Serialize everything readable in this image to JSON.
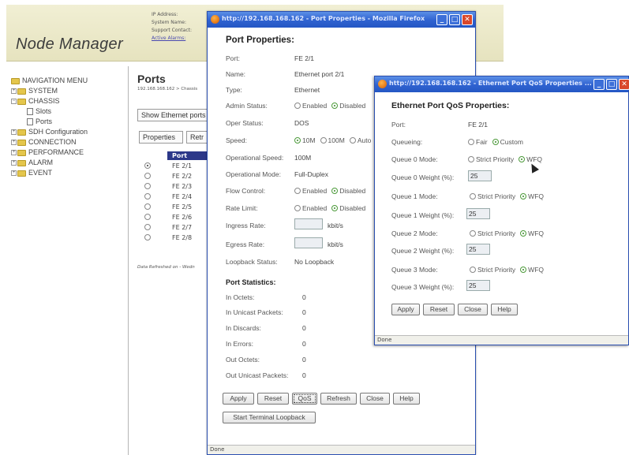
{
  "app": {
    "logo": "Node Manager",
    "header_fields": [
      "IP Address:",
      "System Name:",
      "Support Contact:",
      "Active Alarms:"
    ]
  },
  "nav": {
    "title": "NAVIGATION MENU",
    "items": [
      "SYSTEM",
      "CHASSIS",
      "Slots",
      "Ports",
      "SDH Configuration",
      "CONNECTION",
      "PERFORMANCE",
      "ALARM",
      "EVENT"
    ]
  },
  "ports_page": {
    "title": "Ports",
    "breadcrumb": "192.168.168.162 > Chassis",
    "filter_select": "Show Ethernet ports",
    "buttons": [
      "Properties",
      "Retr"
    ],
    "table_header": "Port",
    "rows": [
      "FE 2/1",
      "FE 2/2",
      "FE 2/3",
      "FE 2/4",
      "FE 2/5",
      "FE 2/6",
      "FE 2/7",
      "FE 2/8"
    ],
    "refresh_note": "Data Refreshed on - Wedn"
  },
  "port_window": {
    "title": "http://192.168.168.162 - Port Properties - Mozilla Firefox",
    "heading": "Port Properties:",
    "fields": {
      "port": {
        "label": "Port:",
        "value": "FE 2/1"
      },
      "name": {
        "label": "Name:",
        "value": "Ethernet port 2/1"
      },
      "type": {
        "label": "Type:",
        "value": "Ethernet"
      },
      "admin_status": {
        "label": "Admin Status:",
        "opt1": "Enabled",
        "opt2": "Disabled"
      },
      "oper_status": {
        "label": "Oper Status:",
        "value": "DOS"
      },
      "speed": {
        "label": "Speed:",
        "opt1": "10M",
        "opt2": "100M",
        "opt3": "Auto"
      },
      "op_speed": {
        "label": "Operational Speed:",
        "value": "100M"
      },
      "op_mode": {
        "label": "Operational Mode:",
        "value": "Full-Duplex"
      },
      "flow_control": {
        "label": "Flow Control:",
        "opt1": "Enabled",
        "opt2": "Disabled"
      },
      "rate_limit": {
        "label": "Rate Limit:",
        "opt1": "Enabled",
        "opt2": "Disabled"
      },
      "ingress": {
        "label": "Ingress Rate:",
        "unit": "kbit/s"
      },
      "egress": {
        "label": "Egress Rate:",
        "unit": "kbit/s"
      },
      "loopback": {
        "label": "Loopback Status:",
        "value": "No Loopback"
      }
    },
    "stats_heading": "Port Statistics:",
    "stats": [
      {
        "label": "In Octets:",
        "value": "0"
      },
      {
        "label": "In Unicast Packets:",
        "value": "0"
      },
      {
        "label": "In Discards:",
        "value": "0"
      },
      {
        "label": "In Errors:",
        "value": "0"
      },
      {
        "label": "Out Octets:",
        "value": "0"
      },
      {
        "label": "Out Unicast Packets:",
        "value": "0"
      }
    ],
    "buttons": {
      "apply": "Apply",
      "reset": "Reset",
      "qos": "QoS",
      "refresh": "Refresh",
      "close": "Close",
      "help": "Help",
      "loopback": "Start Terminal Loopback"
    },
    "status": "Done"
  },
  "qos_window": {
    "title": "http://192.168.168.162 - Ethernet Port QoS Properties ...",
    "heading": "Ethernet Port QoS Properties:",
    "port": {
      "label": "Port:",
      "value": "FE 2/1"
    },
    "queueing": {
      "label": "Queueing:",
      "opt1": "Fair",
      "opt2": "Custom"
    },
    "queues": [
      {
        "mode_label": "Queue 0 Mode:",
        "weight_label": "Queue 0 Weight (%):",
        "weight": "25"
      },
      {
        "mode_label": "Queue 1 Mode:",
        "weight_label": "Queue 1 Weight (%):",
        "weight": "25"
      },
      {
        "mode_label": "Queue 2 Mode:",
        "weight_label": "Queue 2 Weight (%):",
        "weight": "25"
      },
      {
        "mode_label": "Queue 3 Mode:",
        "weight_label": "Queue 3 Weight (%):",
        "weight": "25"
      }
    ],
    "mode_opt1": "Strict Priority",
    "mode_opt2": "WFQ",
    "buttons": {
      "apply": "Apply",
      "reset": "Reset",
      "close": "Close",
      "help": "Help"
    },
    "status": "Done"
  }
}
